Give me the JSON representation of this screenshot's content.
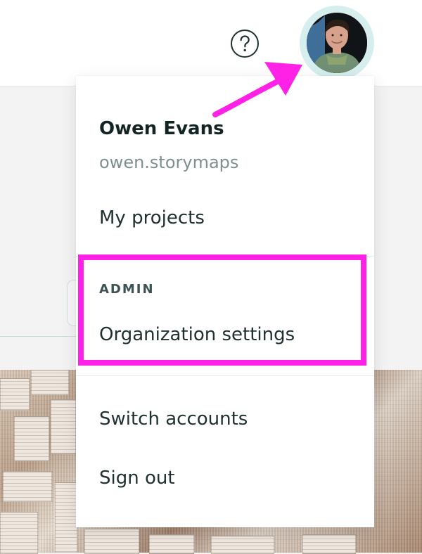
{
  "header": {
    "help_icon": "question-circle-icon",
    "avatar_alt": "Owen Evans avatar"
  },
  "user": {
    "name": "Owen Evans",
    "username": "owen.storymaps"
  },
  "menu": {
    "my_projects": "My projects",
    "admin_label": "ADMIN",
    "organization_settings": "Organization settings",
    "switch_accounts": "Switch accounts",
    "sign_out": "Sign out"
  },
  "colors": {
    "annotation": "#ff22e6",
    "avatar_ring": "#d6efee",
    "primary_text": "#132424",
    "secondary_text": "#7f8f8f"
  }
}
